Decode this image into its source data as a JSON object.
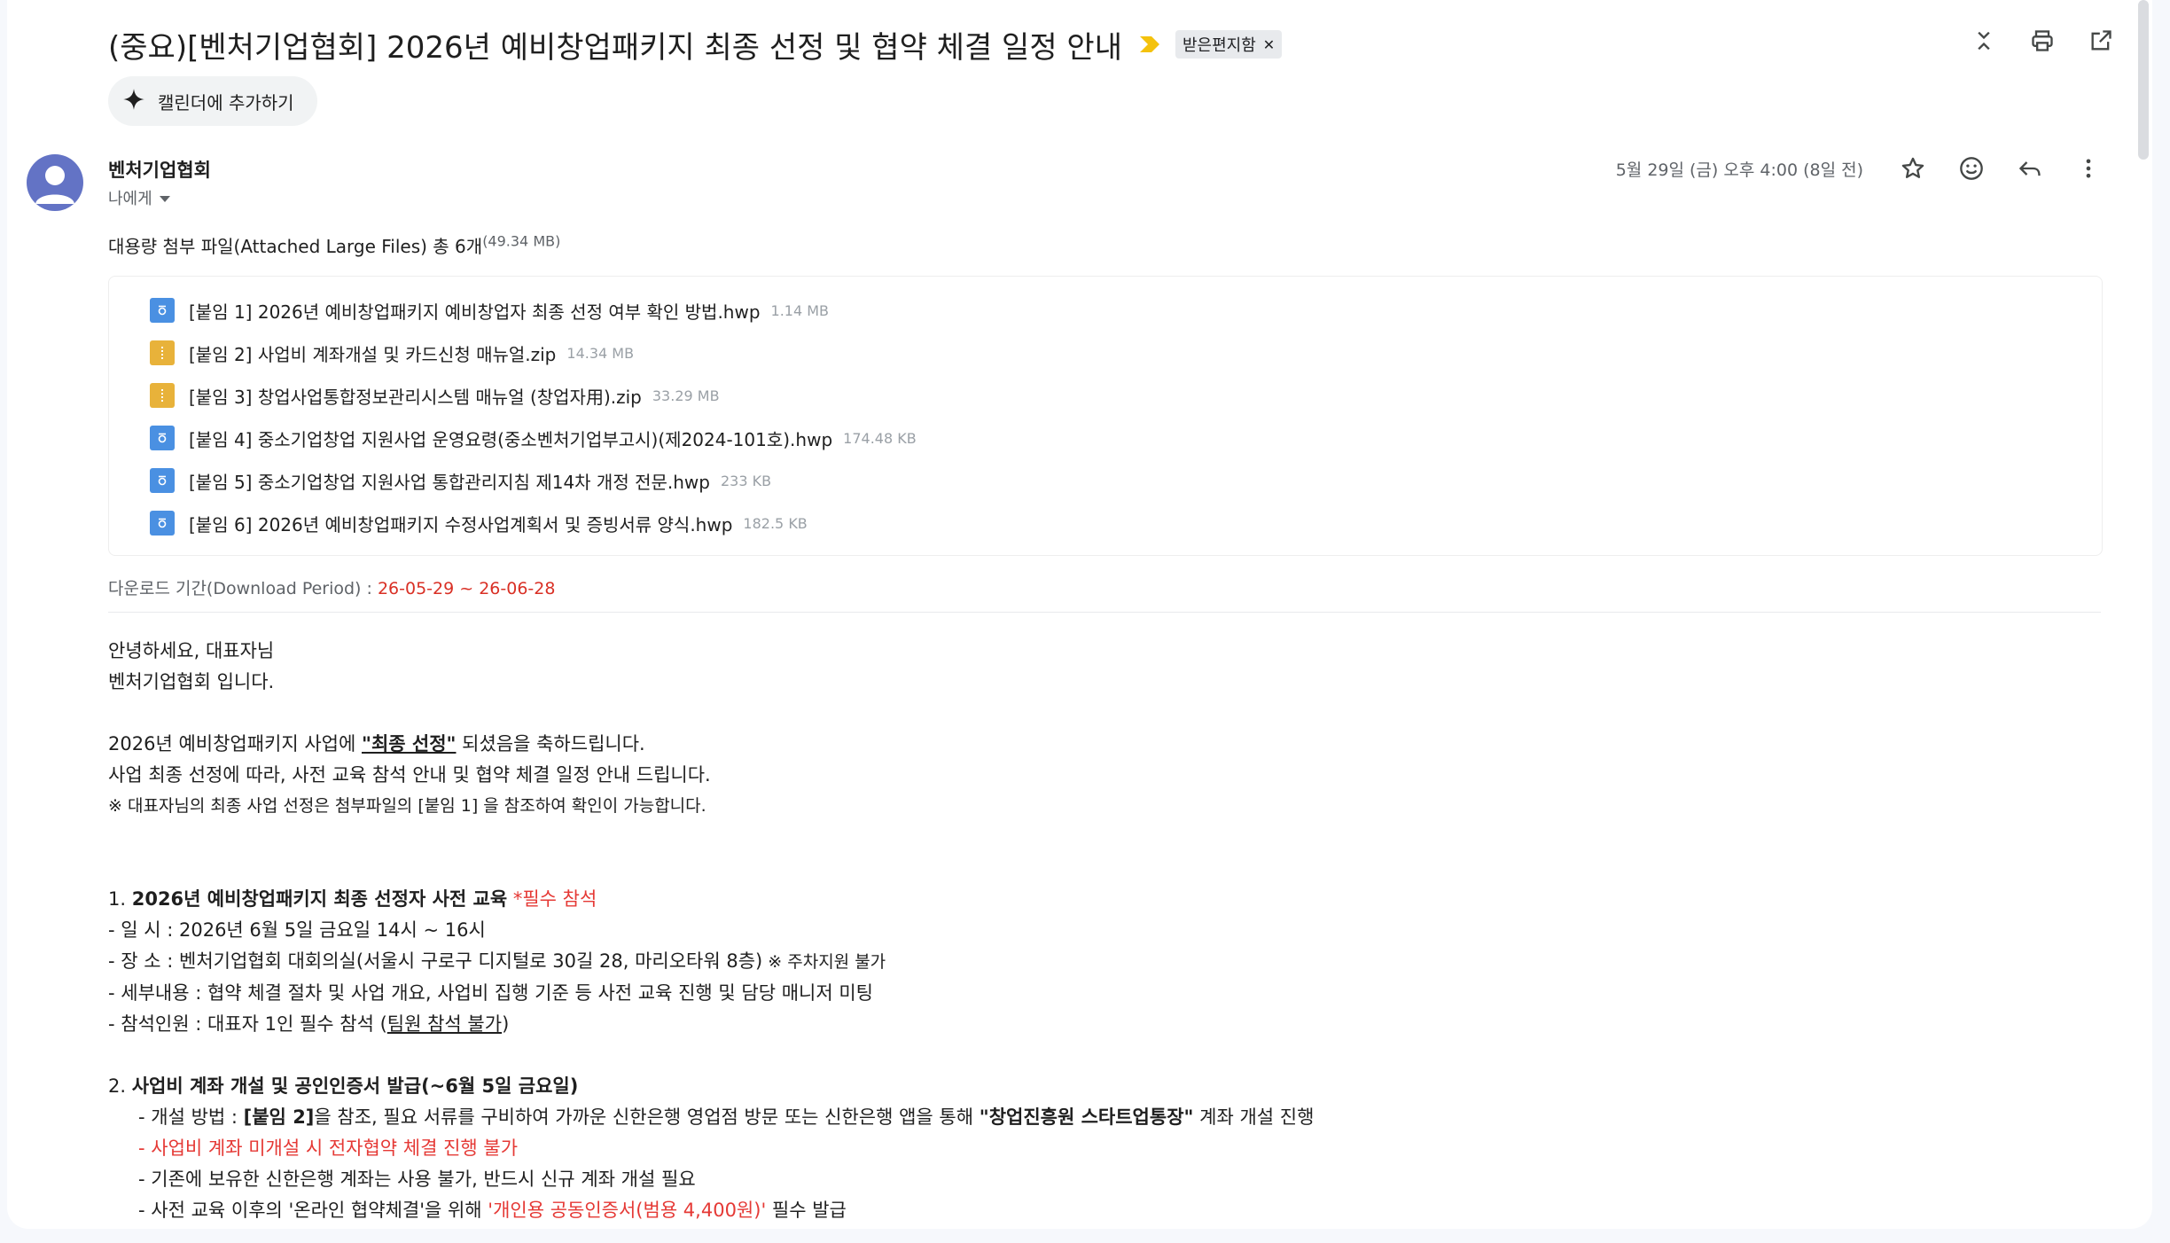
{
  "subject": {
    "title": "(중요)[벤처기업협회] 2026년 예비창업패키지 최종 선정 및 협약 체결 일정 안내",
    "label": "받은편지함"
  },
  "calendar_button": "캘린더에 추가하기",
  "message": {
    "sender": "벤처기업협회",
    "to": "나에게",
    "date": "5월 29일 (금) 오후 4:00 (8일 전)"
  },
  "attachments": {
    "header": "대용량 첨부 파일(Attached Large Files) 총 6개",
    "total_size": "(49.34 MB)",
    "files": [
      {
        "name": "[붙임 1] 2026년 예비창업패키지 예비창업자 최종 선정 여부 확인 방법.hwp",
        "size": "1.14 MB",
        "type": "hwp"
      },
      {
        "name": "[붙임 2] 사업비 계좌개설 및 카드신청 매뉴얼.zip",
        "size": "14.34 MB",
        "type": "zip"
      },
      {
        "name": "[붙임 3] 창업사업통합정보관리시스템 매뉴얼 (창업자用).zip",
        "size": "33.29 MB",
        "type": "zip"
      },
      {
        "name": "[붙임 4] 중소기업창업 지원사업 운영요령(중소벤처기업부고시)(제2024-101호).hwp",
        "size": "174.48 KB",
        "type": "hwp"
      },
      {
        "name": "[붙임 5] 중소기업창업 지원사업 통합관리지침 제14차 개정 전문.hwp",
        "size": "233 KB",
        "type": "hwp"
      },
      {
        "name": "[붙임 6] 2026년 예비창업패키지 수정사업계획서 및 증빙서류 양식.hwp",
        "size": "182.5 KB",
        "type": "hwp"
      }
    ],
    "download_label": "다운로드 기간(Download Period) : ",
    "download_period": "26-05-29 ~ 26-06-28"
  },
  "body": {
    "greeting1": "안녕하세요, 대표자님",
    "greeting2": "벤처기업협회 입니다.",
    "congrats_pre": "2026년 예비창업패키지 사업에 ",
    "congrats_emph": "\"최종 선정\"",
    "congrats_post": " 되셨음을 축하드립니다.",
    "guide": "사업 최종 선정에 따라, 사전 교육 참석 안내 및 협약 체결 일정 안내 드립니다.",
    "note": "※ 대표자님의 최종 사업 선정은 첨부파일의 [붙임 1] 을 참조하여 확인이 가능합니다.",
    "s1_num": "1. ",
    "s1_title": "2026년 예비창업패키지 최종 선정자 사전 교육",
    "s1_required": " *필수 참석",
    "s1_date": "- 일 시 : 2026년 6월 5일 금요일 14시 ~ 16시",
    "s1_place": "- 장 소 : 벤처기업협회 대회의실(서울시 구로구 디지털로 30길 28, 마리오타워 8층)",
    "s1_parking": "  ※ 주차지원 불가",
    "s1_detail": "- 세부내용 : 협약 체결 절차 및 사업 개요, 사업비 집행 기준 등 사전 교육 진행 및 담당 매니저 미팅",
    "s1_attend_pre": "- 참석인원 : 대표자 1인 필수 참석 (",
    "s1_attend_u": "팀원 참석 불가",
    "s1_attend_post": ")",
    "s2_num": "2. ",
    "s2_title": "사업비 계좌 개설 및 공인인증서 발급(~6월 5일 금요일)",
    "s2_l1_pre": "- 개설 방법 : ",
    "s2_l1_b1": "[붙임 2]",
    "s2_l1_mid": "을 참조, 필요 서류를 구비하여 가까운 신한은행 영업점 방문 또는 신한은행 앱을 통해 ",
    "s2_l1_b2": "\"창업진흥원 스타트업통장\"",
    "s2_l1_post": " 계좌 개설 진행",
    "s2_l2": "- 사업비 계좌 미개설 시 전자협약 체결 진행 불가",
    "s2_l3": "- 기존에 보유한 신한은행 계좌는 사용 불가, 반드시 신규 계좌 개설 필요",
    "s2_l4_pre": "- 사전 교육 이후의 '온라인 협약체결'을 위해 ",
    "s2_l4_red": "'개인용 공동인증서(범용 4,400원)'",
    "s2_l4_post": " 필수 발급"
  },
  "icons": {
    "important": "important-marker-icon",
    "label_remove": "close-icon",
    "collapse": "collapse-all-icon",
    "print": "print-icon",
    "open_new": "open-in-new-window-icon",
    "sparkle": "sparkle-icon",
    "star": "star-icon",
    "emoji": "emoji-react-icon",
    "reply": "reply-icon",
    "more": "more-vert-icon"
  },
  "colors": {
    "accent_red": "#e53935",
    "avatar": "#6373c5",
    "important_marker": "#f4c20d"
  }
}
